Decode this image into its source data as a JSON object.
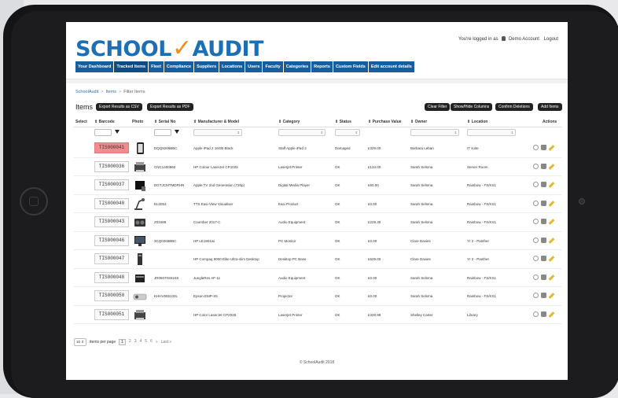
{
  "logo": {
    "left": "SCHOOL",
    "check": "✓",
    "right": "AUDIT"
  },
  "login": {
    "text": "You're logged in as",
    "user": "Demo Account",
    "logout": "Logout"
  },
  "nav": [
    "Your Dashboard",
    "Tracked Items",
    "Fleet",
    "Compliance",
    "Suppliers",
    "Locations",
    "Users",
    "Faculty",
    "Categories",
    "Reports",
    "Custom Fields",
    "Edit account details"
  ],
  "nav_active": "Tracked Items",
  "breadcrumb": {
    "root": "SchoolAudit",
    "mid": "Items",
    "current": "Filter Items"
  },
  "page_title": "Items",
  "buttons": {
    "export_csv": "Export Results as CSV",
    "export_pdf": "Export Results as PDF",
    "clear_filter": "Clear Filter",
    "show_hide": "Show/Hide Columns",
    "confirm_deletions": "Confirm Deletions",
    "add_items": "Add Items"
  },
  "columns": {
    "select": "Select",
    "barcode": "Barcode",
    "photo": "Photo",
    "serial": "Serial No",
    "manufacturer": "Manufacturer & Model",
    "category": "Category",
    "status": "Status",
    "purchase": "Purchase Value",
    "owner": "Owner",
    "location": "Location",
    "actions": "Actions"
  },
  "rows": [
    {
      "barcode": "TIS000041",
      "serial": "DQQ9266BBC",
      "model": "Apple iPad 2 16GB Black",
      "category": "Staff Apple iPad 2",
      "status": "Damaged",
      "value": "£329.00",
      "owner": "Barbara Leban",
      "location": "IT suite",
      "photo": "tablet-icon",
      "highlight": true
    },
    {
      "barcode": "TIS000036",
      "serial": "CNC1400860",
      "model": "HP Colour LaserJet CP1025",
      "category": "Laserjet Printer",
      "status": "OK",
      "value": "£134.00",
      "owner": "Sarah Selsma",
      "location": "Server Room",
      "photo": "printer-icon",
      "highlight": false
    },
    {
      "barcode": "TIS000037",
      "serial": "DGTJCMTMDRHN",
      "model": "Apple TV 2nd Generation (720p)",
      "category": "Digital Media Player",
      "status": "OK",
      "value": "£60.00",
      "owner": "Sarah Selsma",
      "location": "Rainbow - FS/KS1",
      "photo": "media-player-icon",
      "highlight": false
    },
    {
      "barcode": "TIS000040",
      "serial": "EL0053",
      "model": "TTS Easi-View Visualiser",
      "category": "Easi Product",
      "status": "OK",
      "value": "£0.00",
      "owner": "Sarah Selsma",
      "location": "Rainbow - FS/KS1",
      "photo": "visualiser-icon",
      "highlight": false
    },
    {
      "barcode": "TIS000043",
      "serial": "Z03488",
      "model": "Coomber 2017-C",
      "category": "Audio Equipment",
      "status": "OK",
      "value": "£229.30",
      "owner": "Sarah Selsma",
      "location": "Rainbow - FS/KS1",
      "photo": "speaker-icon",
      "highlight": false
    },
    {
      "barcode": "TIS000046",
      "serial": "3CQ0265BBC",
      "model": "HP LE1901wi",
      "category": "PC Monitor",
      "status": "OK",
      "value": "£0.00",
      "owner": "Clare Davies",
      "location": "Yr 2 - Panther",
      "photo": "monitor-icon",
      "highlight": false
    },
    {
      "barcode": "TIS000047",
      "serial": "",
      "model": "HP Compaq 8000 Elite Ultra-slim Desktop",
      "category": "Desktop PC Base",
      "status": "OK",
      "value": "£629.00",
      "owner": "Clare Davies",
      "location": "Yr 2 - Panther",
      "photo": "desktop-icon",
      "highlight": false
    },
    {
      "barcode": "TIS000048",
      "serial": "JR05070S5248",
      "model": "JungleRes AF-11",
      "category": "Audio Equipment",
      "status": "OK",
      "value": "£0.00",
      "owner": "Sarah Selsma",
      "location": "Rainbow - FS/KS1",
      "photo": "audio-icon",
      "highlight": false
    },
    {
      "barcode": "TIS000050",
      "serial": "KHHV655132L",
      "model": "Epson EMP-S5",
      "category": "Projector",
      "status": "OK",
      "value": "£0.00",
      "owner": "Sarah Selsma",
      "location": "Rainbow - FS/KS1",
      "photo": "projector-icon",
      "highlight": false
    },
    {
      "barcode": "TIS000051",
      "serial": "",
      "model": "HP Color LaserJet CP2025",
      "category": "Laserjet Printer",
      "status": "OK",
      "value": "£328.99",
      "owner": "Shelley Carter",
      "location": "Library",
      "photo": "printer-icon",
      "highlight": false
    }
  ],
  "pager": {
    "per_page_value": "10",
    "per_page_label": "items per page",
    "pages": [
      "1",
      "2",
      "3",
      "4",
      "5",
      "6"
    ],
    "current": "1",
    "next": "»",
    "last": "Last »"
  },
  "footer": "© SchoolAudit 2018",
  "colors": {
    "nav": "#175e9e",
    "nav_active": "#0d4c85",
    "logo_blue": "#1d6fb5",
    "logo_check": "#f08b1e",
    "highlight": "#f08c8f"
  }
}
